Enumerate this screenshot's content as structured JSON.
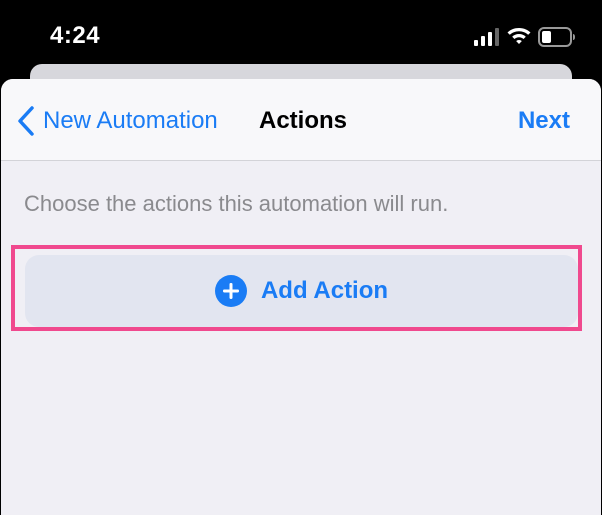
{
  "status_bar": {
    "time": "4:24",
    "signal_icon": "cellular-signal-icon",
    "wifi_icon": "wifi-icon",
    "battery_icon": "battery-icon"
  },
  "nav": {
    "back_label": "New Automation",
    "title": "Actions",
    "next_label": "Next"
  },
  "content": {
    "description": "Choose the actions this automation will run.",
    "add_action_label": "Add Action"
  },
  "colors": {
    "accent": "#1a7cf5",
    "highlight": "#f0498e",
    "sheet_background": "#f0eff5",
    "button_background": "#e2e5f0"
  }
}
